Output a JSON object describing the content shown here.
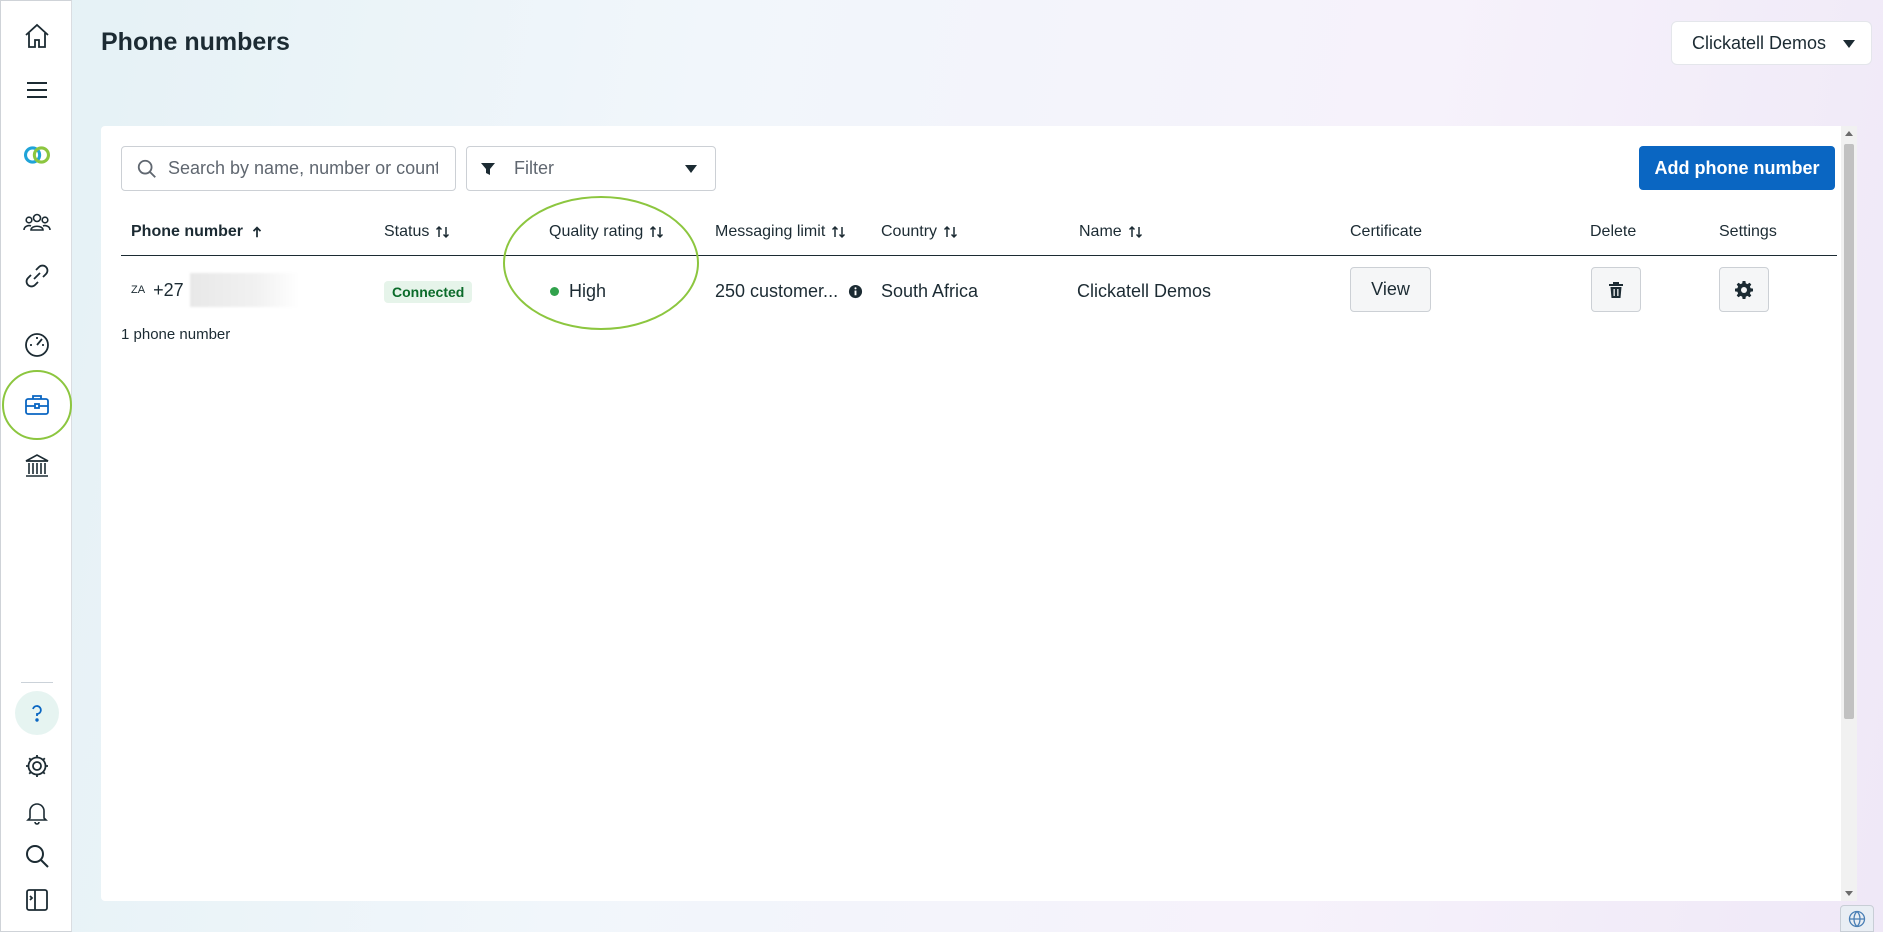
{
  "page": {
    "title": "Phone numbers",
    "account_selector": "Clickatell Demos"
  },
  "rail": {
    "items": [
      "home-icon",
      "menu-icon",
      "clickatell-logo-icon",
      "contacts-icon",
      "integrations-icon",
      "dashboard-icon",
      "business-tools-icon",
      "billing-icon"
    ],
    "bottom_items": [
      "help-icon",
      "settings-icon",
      "notifications-icon",
      "search-icon",
      "panel-toggle-icon"
    ],
    "active_item": "business-tools-icon"
  },
  "toolbar": {
    "search_placeholder": "Search by name, number or country",
    "filter_label": "Filter",
    "add_button": "Add phone number"
  },
  "table": {
    "columns": {
      "phone_number": "Phone number",
      "status": "Status",
      "quality_rating": "Quality rating",
      "messaging_limit": "Messaging limit",
      "country": "Country",
      "name": "Name",
      "certificate": "Certificate",
      "delete": "Delete",
      "settings": "Settings"
    },
    "rows": [
      {
        "country_code": "ZA",
        "dial_prefix": "+27",
        "status": "Connected",
        "quality_rating": "High",
        "messaging_limit": "250 customer...",
        "country": "South Africa",
        "name": "Clickatell Demos",
        "certificate_button": "View"
      }
    ],
    "row_count": "1 phone number"
  },
  "colors": {
    "primary": "#0a66c2",
    "status_connected": "#0b6b2a",
    "quality_high": "#31a24c",
    "highlight_ring": "#8cc63f"
  }
}
